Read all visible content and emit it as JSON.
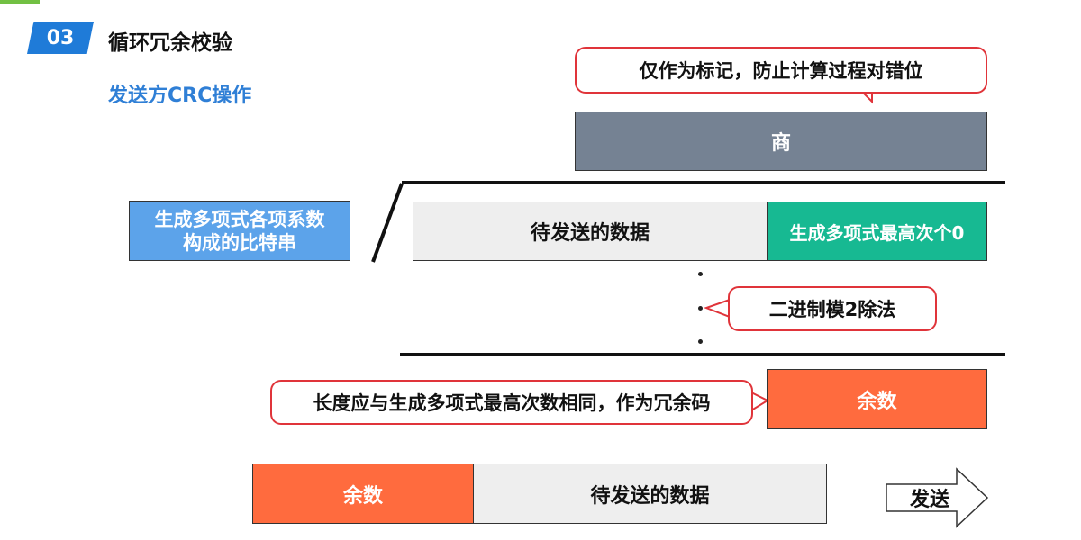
{
  "section": {
    "number": "03",
    "title": "循环冗余校验"
  },
  "subtitle": "发送方CRC操作",
  "callouts": {
    "marker": "仅作为标记，防止计算过程对错位",
    "mod2": "二进制模2除法",
    "remainder_length": "长度应与生成多项式最高次数相同，作为冗余码"
  },
  "boxes": {
    "quotient": "商",
    "generator_line1": "生成多项式各项系数",
    "generator_line2": "构成的比特串",
    "data": "待发送的数据",
    "zeros": "生成多项式最高次个0",
    "remainder": "余数"
  },
  "final_frame": {
    "remainder": "余数",
    "data": "待发送的数据"
  },
  "send": "发送",
  "colors": {
    "badge": "#1f7bd8",
    "subtitle": "#2f7fd6",
    "quotient": "#758293",
    "generator": "#5ca3ea",
    "zeros": "#17b992",
    "remainder": "#ff6b3e",
    "data": "#eeeeee",
    "callout_border": "#e0343a"
  }
}
